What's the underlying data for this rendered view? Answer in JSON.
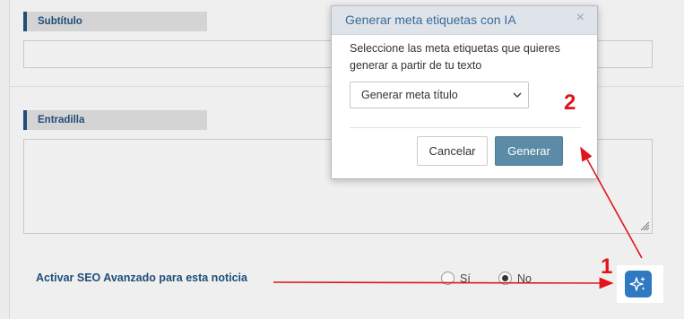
{
  "form": {
    "subtitle_label": "Subtítulo",
    "lead_label": "Entradilla",
    "seo_label": "Activar SEO Avanzado para esta noticia",
    "radio_yes": "Sí",
    "radio_no": "No",
    "radio_selected": "No"
  },
  "modal": {
    "title": "Generar meta etiquetas con IA",
    "close": "×",
    "instruction": "Seleccione las meta etiquetas que quieres generar a partir de tu texto",
    "select_value": "Generar meta título",
    "cancel_label": "Cancelar",
    "generate_label": "Generar"
  },
  "annotations": {
    "step1": "1",
    "step2": "2",
    "color": "#e0141a"
  },
  "colors": {
    "label_blue": "#1f4e79",
    "ai_button": "#2e79c2",
    "generate_button": "#5b8ba6"
  },
  "icons": {
    "ai": "sparkles-icon",
    "close": "close-icon",
    "select": "chevron-down-icon"
  }
}
